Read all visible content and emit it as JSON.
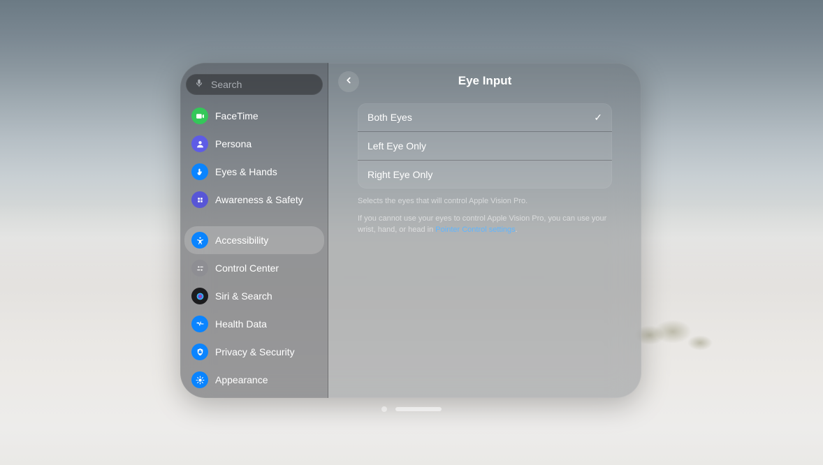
{
  "search": {
    "placeholder": "Search"
  },
  "header": {
    "title": "Eye Input"
  },
  "sidebar": {
    "items": [
      {
        "label": "FaceTime",
        "icon": "facetime",
        "color": "#34c759"
      },
      {
        "label": "Persona",
        "icon": "persona",
        "color": "#5e5ce6"
      },
      {
        "label": "Eyes & Hands",
        "icon": "eyes-hands",
        "color": "#0a84ff"
      },
      {
        "label": "Awareness & Safety",
        "icon": "awareness",
        "color": "#5856d6"
      },
      {
        "label": "Accessibility",
        "icon": "accessibility",
        "color": "#0a84ff",
        "selected": true
      },
      {
        "label": "Control Center",
        "icon": "control-center",
        "color": "#8e8e93"
      },
      {
        "label": "Siri & Search",
        "icon": "siri",
        "color": "#1c1c1e"
      },
      {
        "label": "Health Data",
        "icon": "health",
        "color": "#0a84ff"
      },
      {
        "label": "Privacy & Security",
        "icon": "privacy",
        "color": "#0a84ff"
      },
      {
        "label": "Appearance",
        "icon": "appearance",
        "color": "#0a84ff"
      }
    ],
    "group_break_after_index": 3
  },
  "options": [
    {
      "label": "Both Eyes",
      "checked": true
    },
    {
      "label": "Left Eye Only",
      "checked": false
    },
    {
      "label": "Right Eye Only",
      "checked": false
    }
  ],
  "footer": {
    "line1": "Selects the eyes that will control Apple Vision Pro.",
    "line2a": "If you cannot use your eyes to control Apple Vision Pro, you can use your wrist, hand, or head in ",
    "link": "Pointer Control settings",
    "line2b": "."
  }
}
